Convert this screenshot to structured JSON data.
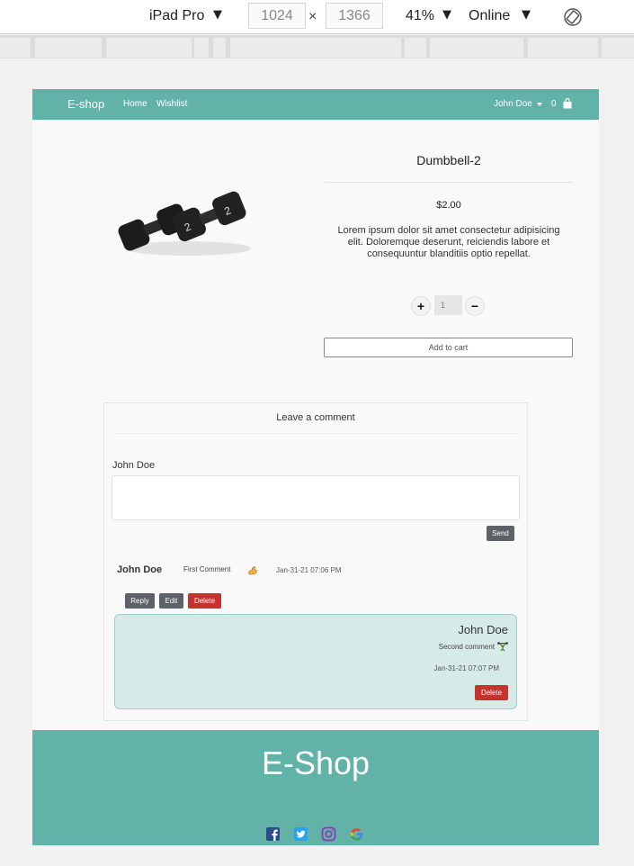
{
  "devtools": {
    "device": "iPad Pro",
    "width": "1024",
    "height": "1366",
    "times": "×",
    "zoom": "41%",
    "network": "Online",
    "dropdown_glyph": "▼"
  },
  "navbar": {
    "brand": "E-shop",
    "links": [
      "Home",
      "Wishlist"
    ],
    "user": "John Doe",
    "cart_count": "0",
    "color": "#63b2a8"
  },
  "product": {
    "title": "Dumbbell-2",
    "price": "$2.00",
    "description": "Lorem ipsum dolor sit amet consectetur adipisicing elit. Doloremque deserunt, reiciendis labore et consequuntur blanditiis optio repellat.",
    "quantity": "1",
    "plus": "+",
    "minus": "−",
    "add_to_cart": "Add to cart"
  },
  "comments": {
    "heading": "Leave a comment",
    "current_user": "John Doe",
    "send_label": "Send",
    "items": [
      {
        "author": "John Doe",
        "text": "First Comment",
        "time": "Jan-31-21 07:06 PM",
        "reply_label": "Reply",
        "edit_label": "Edit",
        "delete_label": "Delete"
      }
    ],
    "replies": [
      {
        "author": "John Doe",
        "text": "Second comment",
        "time": "Jan-31-21 07:07 PM",
        "delete_label": "Delete"
      }
    ]
  },
  "footer": {
    "brand": "E-Shop",
    "social_icons": [
      "facebook-icon",
      "twitter-icon",
      "instagram-icon",
      "google-icon"
    ]
  }
}
